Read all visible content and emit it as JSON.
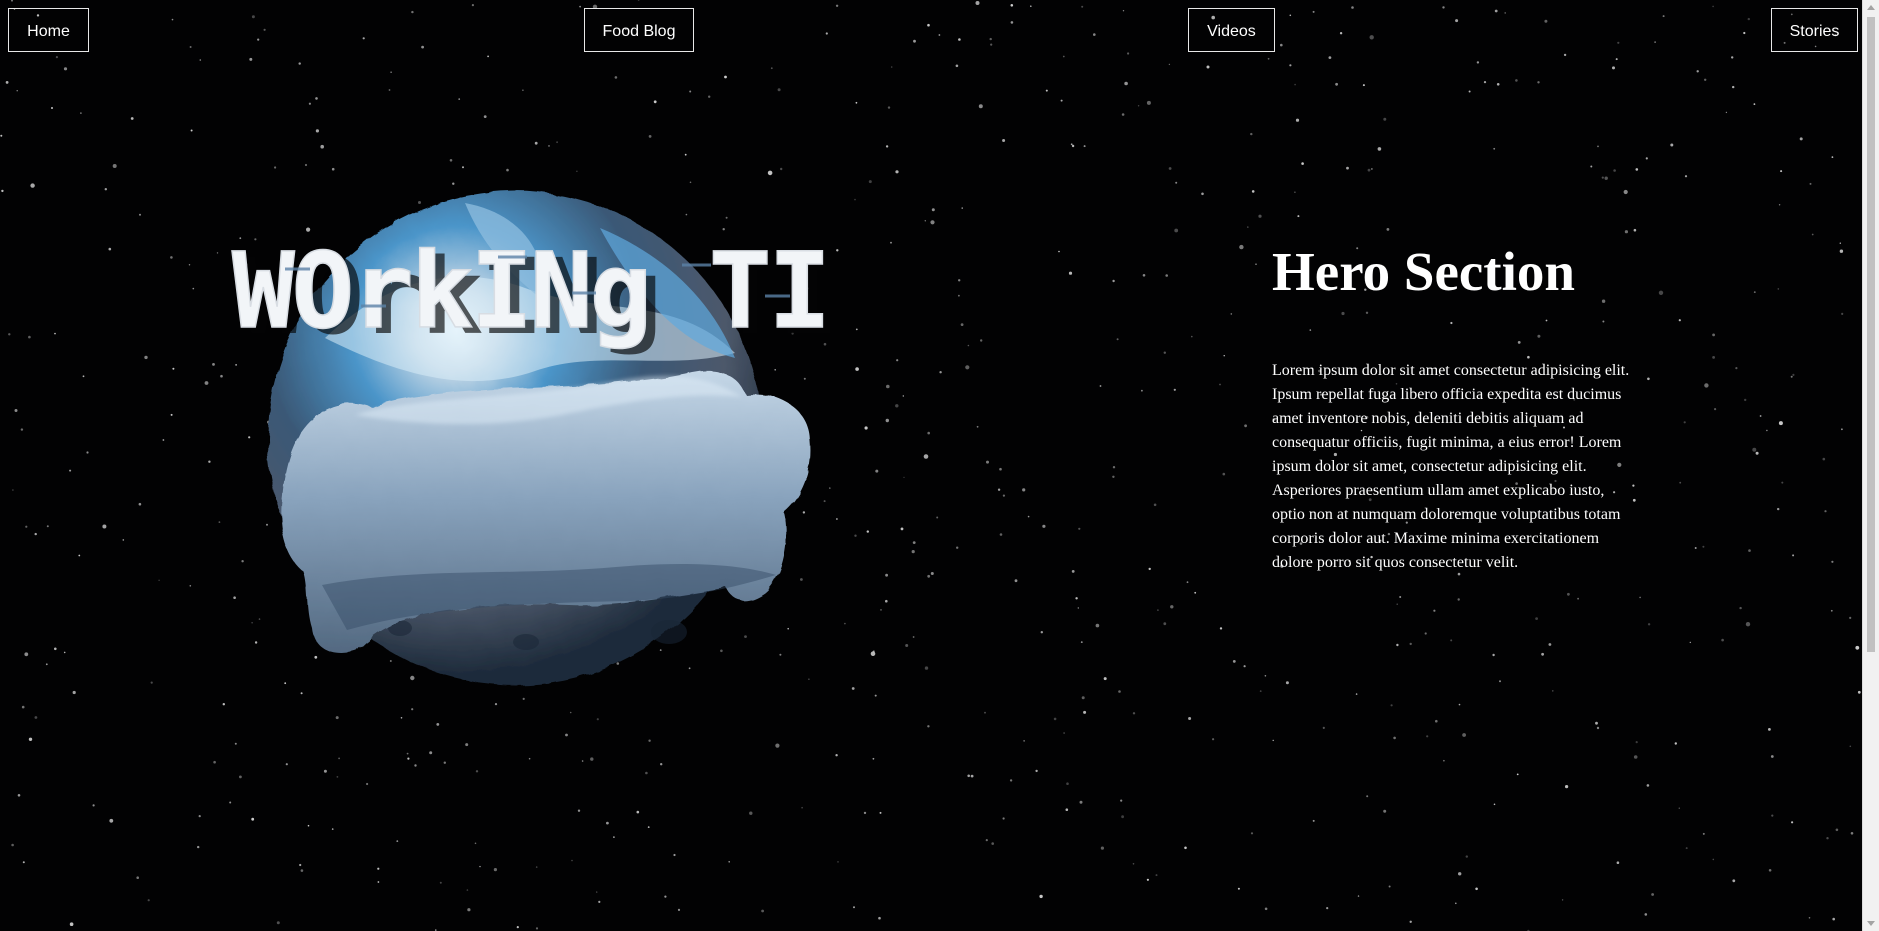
{
  "nav": {
    "home_label": "Home",
    "food_blog_label": "Food Blog",
    "videos_label": "Videos",
    "stories_label": "Stories"
  },
  "logo": {
    "text": "WOrkINg TItlE"
  },
  "hero": {
    "title": "Hero Section",
    "body": "Lorem ipsum dolor sit amet consectetur adipisicing elit. Ipsum repellat fuga libero officia expedita est ducimus amet inventore nobis, deleniti debitis aliquam ad consequatur officiis, fugit minima, a eius error! Lorem ipsum dolor sit amet, consectetur adipisicing elit. Asperiores praesentium ullam amet explicabo iusto, optio non at numquam doloremque voluptatibus totam corporis dolor aut. Maxime minima exercitationem dolore porro sit quos consectetur velit."
  },
  "colors": {
    "background": "#020203",
    "text": "#ffffff",
    "planet_blue": "#2f7db8",
    "bone_gray": "#8aa4bd"
  },
  "icons": {
    "scroll_up": "scroll-up-arrow-icon",
    "scroll_down": "scroll-down-arrow-icon"
  }
}
